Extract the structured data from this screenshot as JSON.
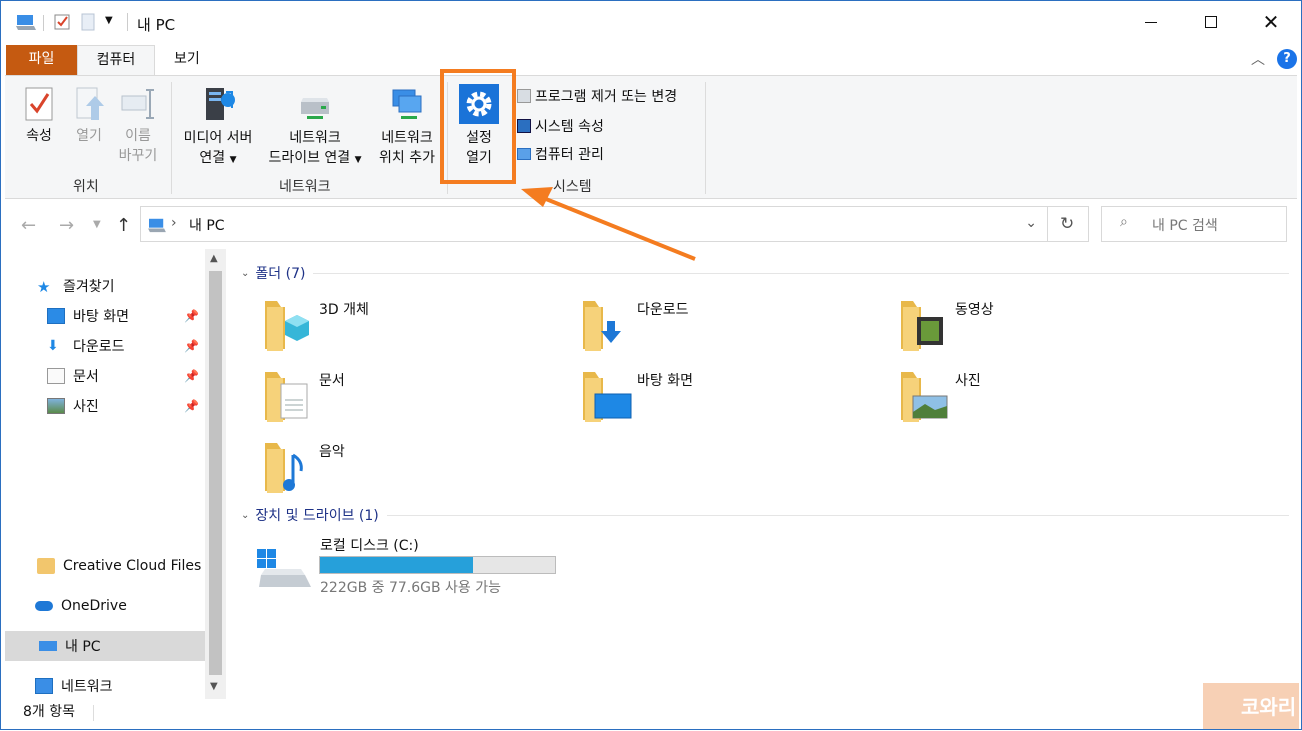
{
  "window": {
    "title": "내 PC"
  },
  "tabs": [
    {
      "label": "파일"
    },
    {
      "label": "컴퓨터"
    },
    {
      "label": "보기"
    }
  ],
  "ribbon": {
    "groups": {
      "location": "위치",
      "network": "네트워크",
      "system": "시스템"
    },
    "properties": {
      "label": "속성"
    },
    "open": {
      "label": "열기"
    },
    "rename": {
      "line1": "이름",
      "line2": "바꾸기"
    },
    "media": {
      "line1": "미디어 서버",
      "line2": "연결"
    },
    "mapdrive": {
      "line1": "네트워크",
      "line2": "드라이브 연결"
    },
    "addloc": {
      "line1": "네트워크",
      "line2": "위치 추가"
    },
    "settings": {
      "line1": "설정",
      "line2": "열기"
    },
    "uninstall": "프로그램 제거 또는 변경",
    "sysprops": "시스템 속성",
    "manage": "컴퓨터 관리"
  },
  "address": {
    "path": "내 PC"
  },
  "search": {
    "placeholder": "내 PC 검색"
  },
  "navpane": {
    "quickaccess": "즐겨찾기",
    "items": [
      {
        "label": "바탕 화면"
      },
      {
        "label": "다운로드"
      },
      {
        "label": "문서"
      },
      {
        "label": "사진"
      }
    ],
    "creative": "Creative Cloud Files",
    "onedrive": "OneDrive",
    "thispc": "내 PC",
    "network": "네트워크"
  },
  "folders": {
    "header": "폴더 (7)",
    "items": [
      {
        "label": "3D 개체"
      },
      {
        "label": "다운로드"
      },
      {
        "label": "동영상"
      },
      {
        "label": "문서"
      },
      {
        "label": "바탕 화면"
      },
      {
        "label": "사진"
      },
      {
        "label": "음악"
      }
    ]
  },
  "drives": {
    "header": "장치 및 드라이브 (1)",
    "items": [
      {
        "label": "로컬 디스크 (C:)",
        "free": "222GB 중 77.6GB 사용 가능",
        "used_fraction": 0.65
      }
    ]
  },
  "status": {
    "count": "8개 항목"
  },
  "watermark": "코와리",
  "colors": {
    "accent": "#f47c20",
    "file_tab": "#c55a11",
    "selected": "#cce8ff",
    "bar": "#26a0da"
  }
}
